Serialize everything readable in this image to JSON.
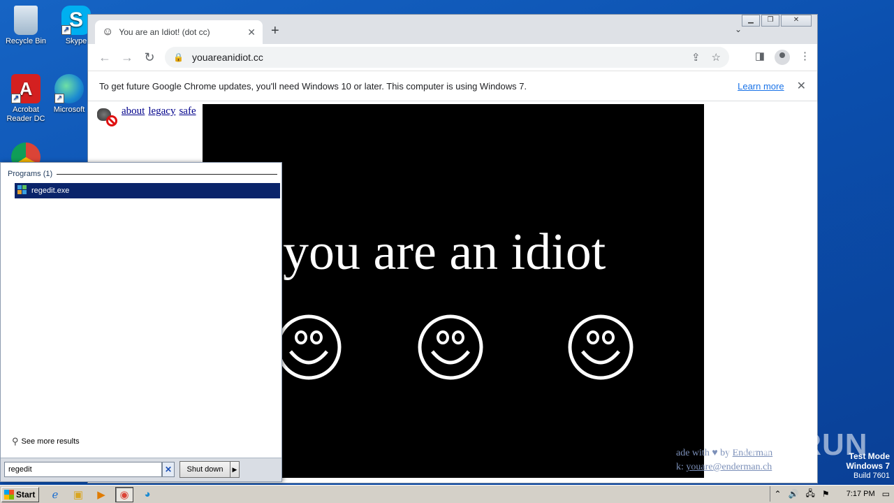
{
  "desktop": {
    "icons": [
      {
        "label": "Recycle Bin"
      },
      {
        "label": "Skype"
      },
      {
        "label": "Acrobat Reader DC"
      },
      {
        "label": "Microsoft"
      }
    ]
  },
  "browser": {
    "tab_title": "You are an Idiot! (dot cc)",
    "url": "youareanidiot.cc",
    "infobar_message": "To get future Google Chrome updates, you'll need Windows 10 or later. This computer is using Windows 7.",
    "infobar_link": "Learn more",
    "page": {
      "links": [
        "about",
        "legacy",
        "safe"
      ],
      "headline": "you are an idiot",
      "footer_line1_a": "ade with",
      "footer_line1_b": "by",
      "footer_author": "Enderman",
      "footer_line2_a": "k:",
      "footer_email": "youare@enderman.ch"
    }
  },
  "start_menu": {
    "section_header": "Programs (1)",
    "result_item": "regedit.exe",
    "see_more": "See more results",
    "search_value": "regedit",
    "shutdown_label": "Shut down"
  },
  "watermark": {
    "brand": "ANY.RUN",
    "test_mode": "Test Mode",
    "os": "Windows 7",
    "build": "Build 7601"
  },
  "taskbar": {
    "start_label": "Start",
    "clock": "7:17 PM"
  },
  "colors": {
    "desktop_bg": "#0b4fae",
    "selection": "#0a246a",
    "link": "#1a73e8"
  }
}
